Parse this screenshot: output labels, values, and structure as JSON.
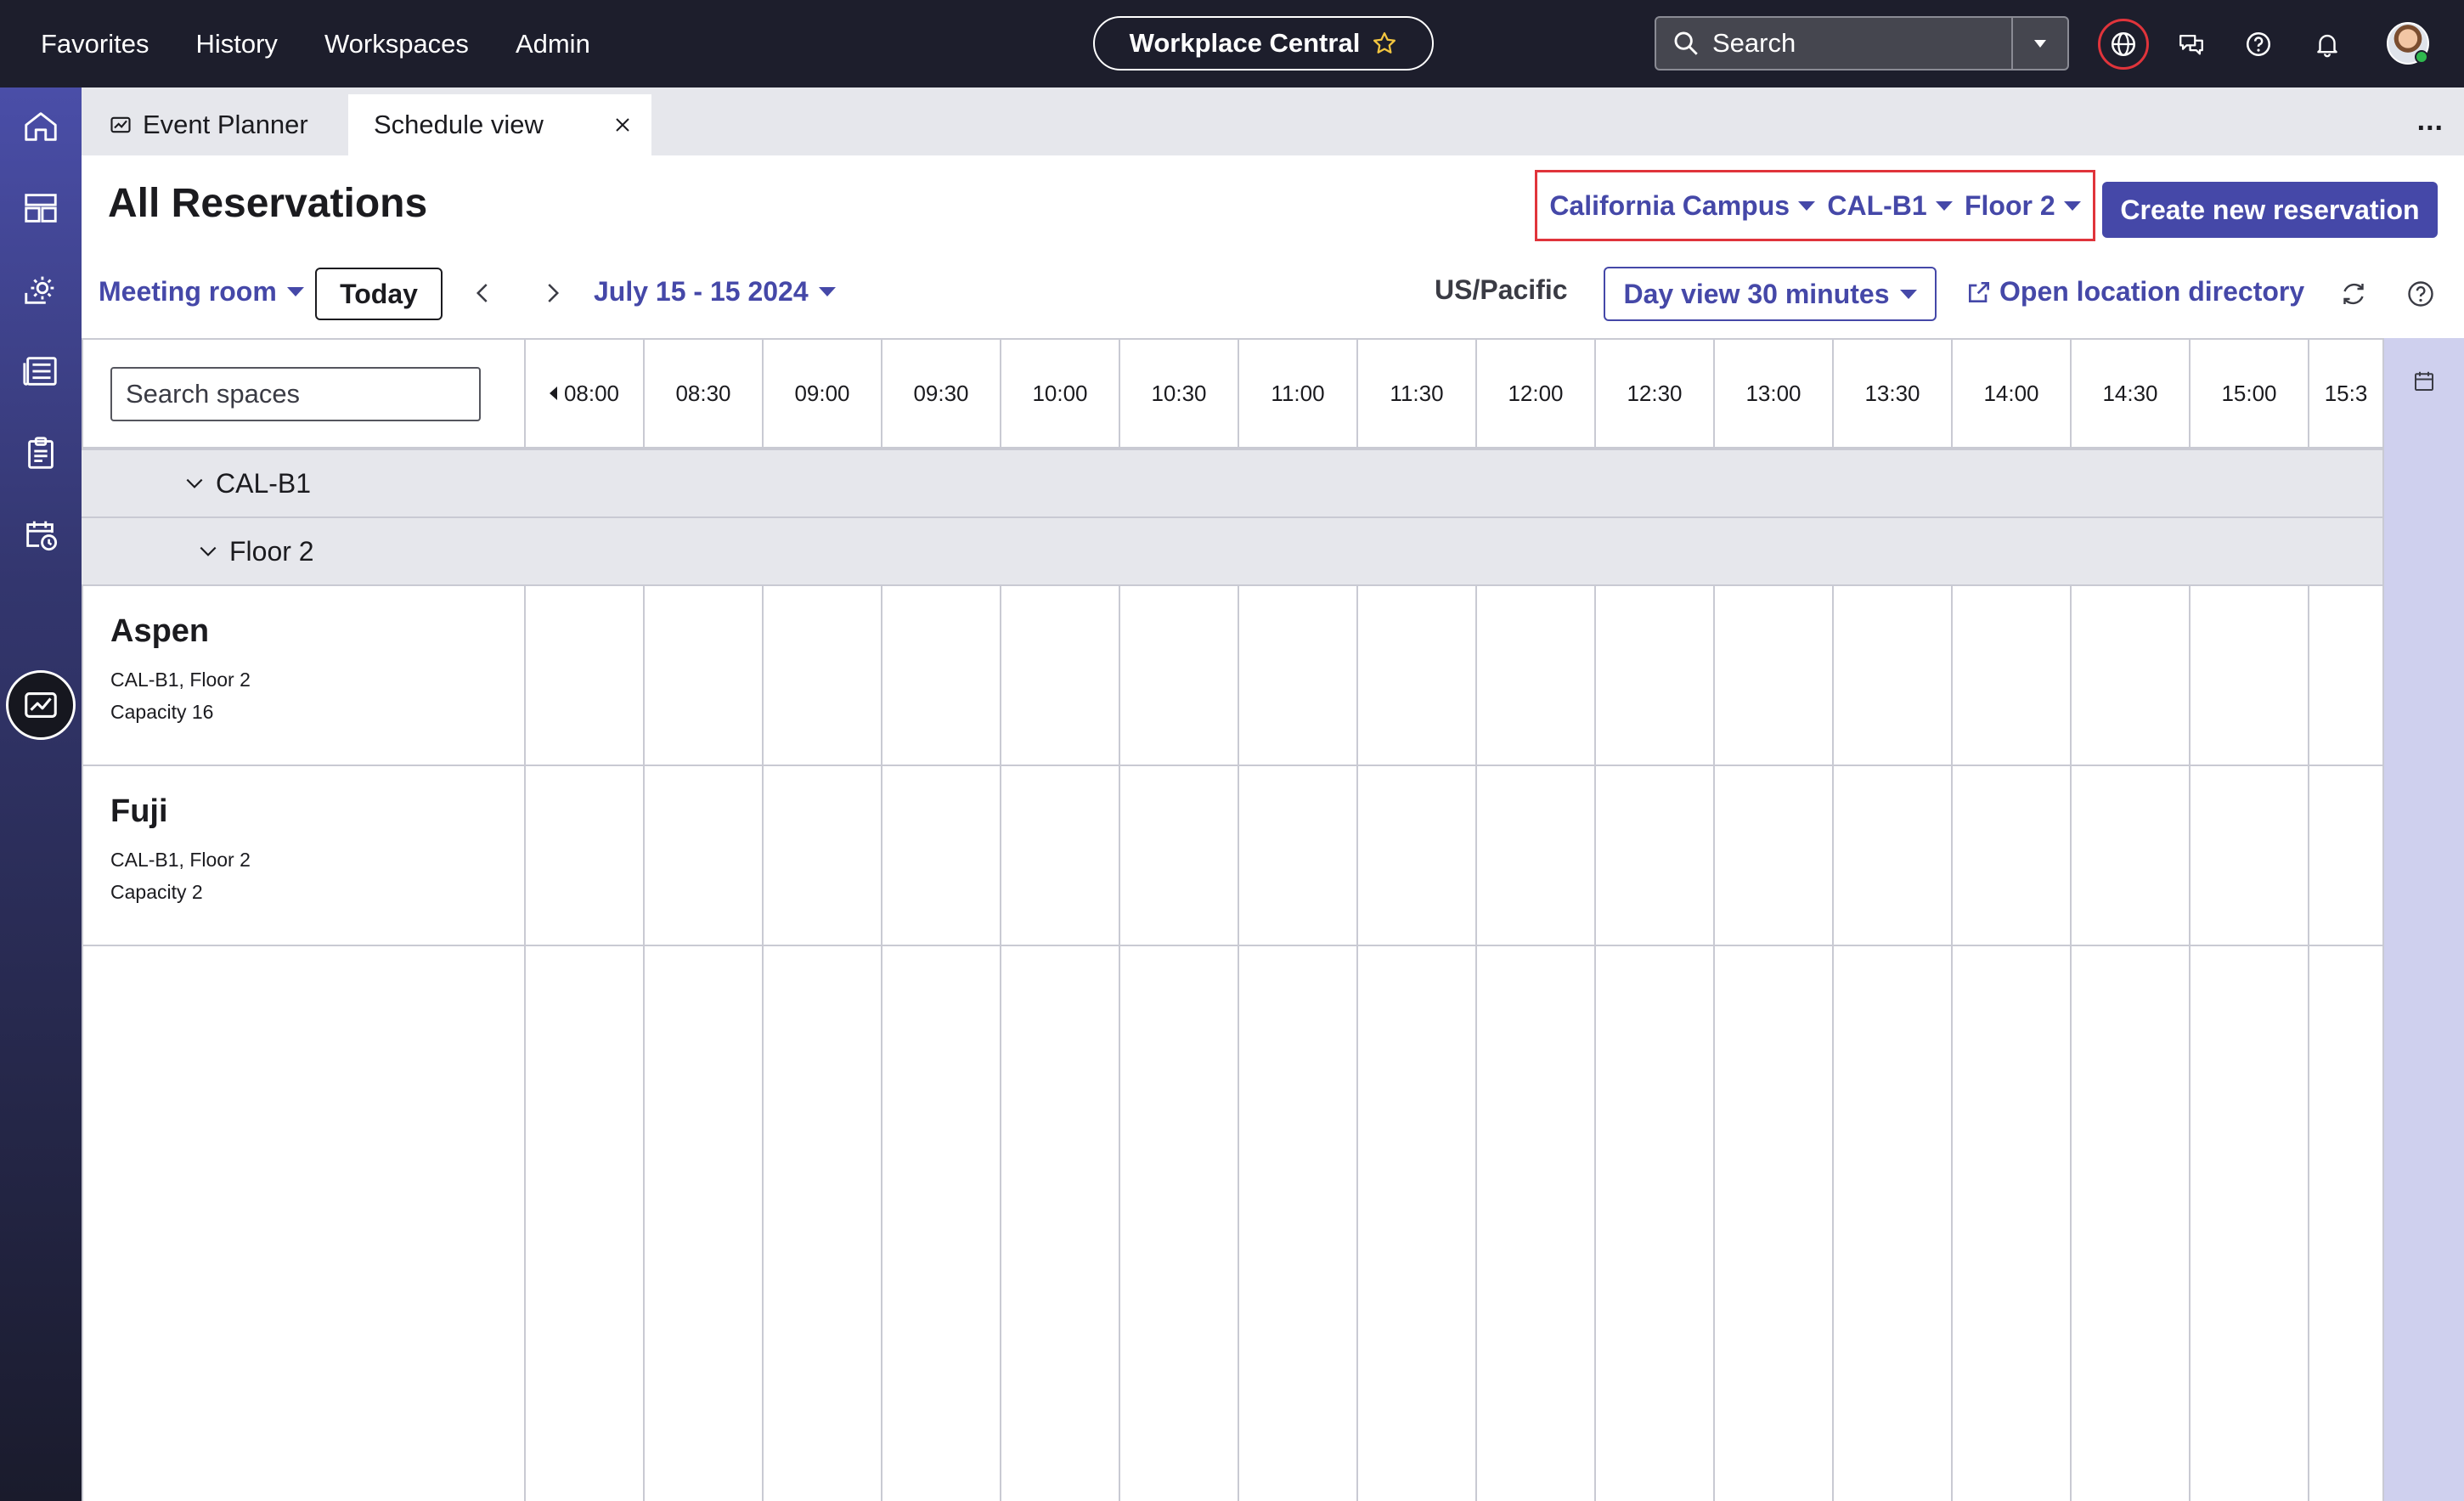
{
  "topbar": {
    "nav": [
      "Favorites",
      "History",
      "Workspaces",
      "Admin"
    ],
    "app_title": "Workplace Central",
    "search_label": "Search"
  },
  "tabs": {
    "items": [
      {
        "label": "Event Planner"
      },
      {
        "label": "Schedule view"
      }
    ],
    "more_label": "..."
  },
  "header": {
    "title": "All Reservations",
    "location": {
      "campus": "California Campus",
      "building": "CAL-B1",
      "floor": "Floor 2"
    },
    "create_label": "Create new reservation"
  },
  "toolbar": {
    "space_type": "Meeting room",
    "today_label": "Today",
    "date_range": "July 15 - 15 2024",
    "timezone": "US/Pacific",
    "view_mode": "Day view 30 minutes",
    "directory_link": "Open location directory"
  },
  "schedule": {
    "search_placeholder": "Search spaces",
    "time_slots": [
      "08:00",
      "08:30",
      "09:00",
      "09:30",
      "10:00",
      "10:30",
      "11:00",
      "11:30",
      "12:00",
      "12:30",
      "13:00",
      "13:30",
      "14:00",
      "14:30",
      "15:00",
      "15:3"
    ],
    "building_group": "CAL-B1",
    "floor_group": "Floor 2",
    "rooms": [
      {
        "name": "Aspen",
        "location": "CAL-B1, Floor 2",
        "capacity": "Capacity 16"
      },
      {
        "name": "Fuji",
        "location": "CAL-B1, Floor 2",
        "capacity": "Capacity 2"
      }
    ]
  },
  "colors": {
    "accent": "#4548a8",
    "topbar_bg": "#1d1e2c",
    "highlight_border": "#e0343b",
    "group_row_bg": "#e6e7ec",
    "right_panel_bg": "#cfd0ee"
  },
  "icons": [
    "star-icon",
    "search-icon",
    "chevron-down-icon",
    "globe-icon",
    "chat-icon",
    "help-icon",
    "bell-icon",
    "home-icon",
    "dashboard-icon",
    "settings-gear-icon",
    "news-icon",
    "clipboard-icon",
    "calendar-clock-icon",
    "event-planner-icon",
    "close-icon",
    "external-link-icon",
    "refresh-icon",
    "calendar-icon"
  ]
}
